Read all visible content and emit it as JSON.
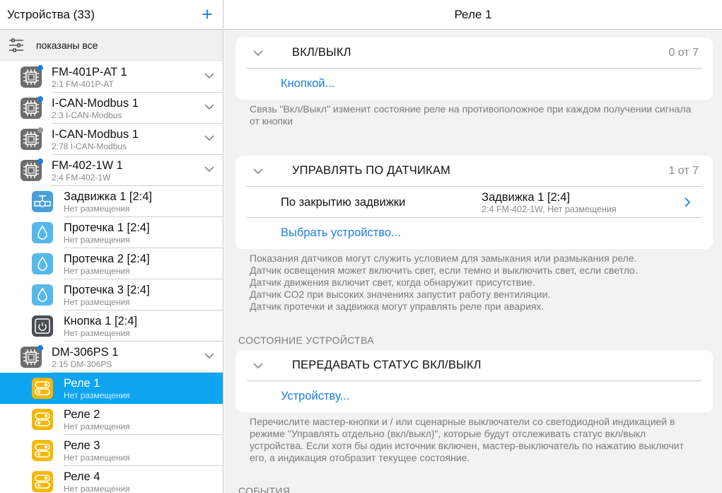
{
  "left": {
    "title": "Устройства (33)",
    "add_icon": "plus-icon",
    "filter_icon": "filter-sliders-icon",
    "filter_text": "показаны все",
    "rows": [
      {
        "name": "FM-401P-AT 1",
        "sub": "2:1 FM-401P-AT",
        "icon": "chip-icon",
        "dot": "blue",
        "type": "device"
      },
      {
        "name": "I-CAN-Modbus 1",
        "sub": "2:3 I-CAN-Modbus",
        "icon": "chip-icon",
        "dot": "blue",
        "type": "device"
      },
      {
        "name": "I-CAN-Modbus 1",
        "sub": "2:78 I-CAN-Modbus",
        "icon": "chip-icon",
        "dot": "grey",
        "type": "device"
      },
      {
        "name": "FM-402-1W 1",
        "sub": "2:4 FM-402-1W",
        "icon": "chip-icon",
        "dot": "blue",
        "type": "device"
      },
      {
        "name": "Задвижка 1 [2:4]",
        "sub": "Нет размещения",
        "icon": "valve-icon",
        "type": "child"
      },
      {
        "name": "Протечка 1 [2:4]",
        "sub": "Нет размещения",
        "icon": "water-drop-icon",
        "type": "child"
      },
      {
        "name": "Протечка 2 [2:4]",
        "sub": "Нет размещения",
        "icon": "water-drop-icon",
        "type": "child"
      },
      {
        "name": "Протечка 3 [2:4]",
        "sub": "Нет размещения",
        "icon": "water-drop-icon",
        "type": "child"
      },
      {
        "name": "Кнопка 1 [2:4]",
        "sub": "Нет размещения",
        "icon": "power-button-icon",
        "type": "child"
      },
      {
        "name": "DM-306PS 1",
        "sub": "2:15 DM-306PS",
        "icon": "chip-icon",
        "dot": "blue",
        "type": "device"
      },
      {
        "name": "Реле 1",
        "sub": "Нет размещения",
        "icon": "relay-icon",
        "type": "child",
        "selected": true
      },
      {
        "name": "Реле 2",
        "sub": "Нет размещения",
        "icon": "relay-icon",
        "type": "child"
      },
      {
        "name": "Реле 3",
        "sub": "Нет размещения",
        "icon": "relay-icon",
        "type": "child"
      },
      {
        "name": "Реле 4",
        "sub": "Нет размещения",
        "icon": "relay-icon",
        "type": "child"
      }
    ]
  },
  "right": {
    "title": "Реле 1",
    "onoff": {
      "header": "ВКЛ/ВЫКЛ",
      "count": "0 от 7",
      "link": "Кнопкой...",
      "note": "Связь \"Вкл/Выкл\" изменит состояние реле на противоположное при каждом получении сигнала от кнопки"
    },
    "sensors": {
      "header": "УПРАВЛЯТЬ ПО ДАТЧИКАМ",
      "count": "1 от 7",
      "row_label": "По закрытию задвижки",
      "row_device": "Задвижка 1 [2:4]",
      "row_device_sub": "2:4 FM-402-1W, Нет размещения",
      "link": "Выбрать устройство...",
      "note_lines": [
        "Показания датчиков могут служить условием для замыкания или размыкания реле.",
        "Датчик освещения может включить свет, если темно и выключить свет, если светло.",
        "Датчик движения включит свет, когда обнаружит присутствие.",
        "Датчик CO2 при высоких значениях запустит работу вентиляции.",
        "Датчик протечки и задвижка могут управлять реле при авариях."
      ]
    },
    "state_section": "СОСТОЯНИЕ УСТРОЙСТВА",
    "status": {
      "header": "ПЕРЕДАВАТЬ СТАТУС ВКЛ/ВЫКЛ",
      "link": "Устройству...",
      "note": "Перечислите мастер-кнопки и / или сценарные выключатели со светодиодной индикацией в режиме \"Управлять отдельно (вкл/выкл)\", которые будут отслеживать статус вкл/выкл устройства. Если хотя бы один источник включен, мастер-выключатель по нажатию выключит его, а индикация отобразит текущее состояние."
    },
    "events_section": "СОБЫТИЯ"
  },
  "colors": {
    "accent": "#1a7fe0",
    "selected": "#0ea5f0",
    "relay": "#f5b800",
    "sensor": "#54b8ea",
    "device": "#6d6d6d"
  }
}
